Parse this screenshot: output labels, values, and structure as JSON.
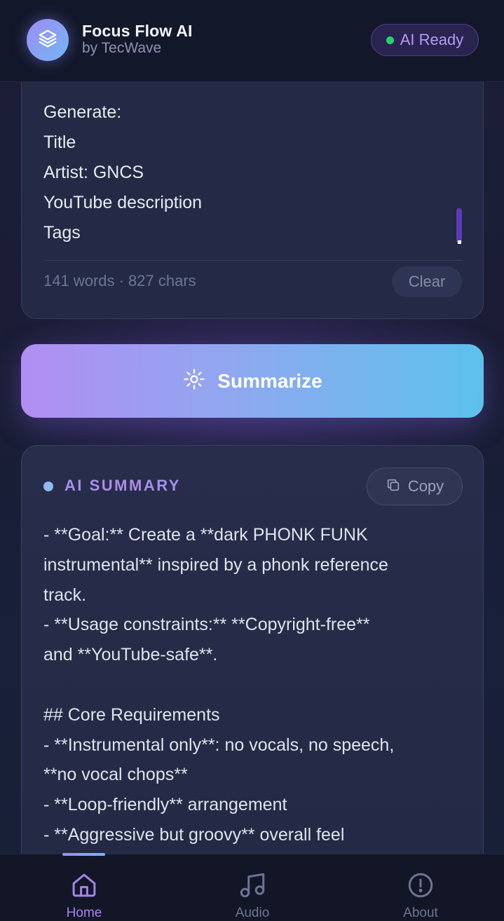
{
  "header": {
    "app_title": "Focus Flow AI",
    "app_subtitle": "by TecWave",
    "logo_icon": "layers-icon",
    "status_label": "AI Ready",
    "status_color": "#22d36b"
  },
  "input": {
    "lines": [
      "Generate:",
      "Title",
      "Artist: GNCS",
      "YouTube description",
      "Tags"
    ],
    "counter": "141 words · 827 chars",
    "clear_label": "Clear"
  },
  "summarize": {
    "label": "Summarize",
    "icon": "sparkle-icon"
  },
  "summary": {
    "heading": "AI SUMMARY",
    "copy_label": "Copy",
    "lines": [
      "- **Goal:** Create a **dark PHONK FUNK",
      "instrumental** inspired by a phonk reference",
      "track.",
      "- **Usage constraints:** **Copyright-free**",
      "and **YouTube-safe**.",
      "",
      "## Core Requirements",
      "- **Instrumental only**: no vocals, no speech,",
      "**no vocal chops**",
      "- **Loop-friendly** arrangement",
      "- **Aggressive but groovy** overall feel"
    ]
  },
  "nav": {
    "items": [
      {
        "label": "Home",
        "icon": "home-icon",
        "active": true
      },
      {
        "label": "Audio",
        "icon": "music-note-icon",
        "active": false
      },
      {
        "label": "About",
        "icon": "info-icon",
        "active": false
      }
    ]
  },
  "colors": {
    "accent_purple": "#a684ee",
    "accent_blue": "#5cc1ec",
    "background": "#1a1d35"
  }
}
